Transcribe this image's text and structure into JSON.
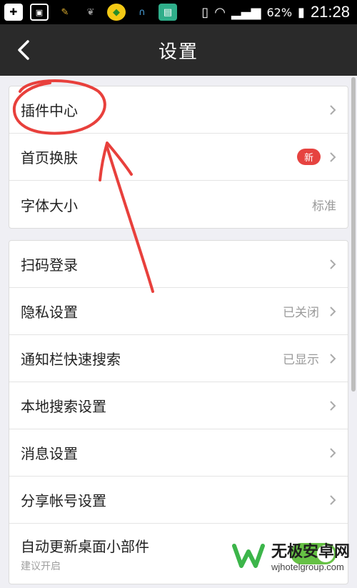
{
  "status_bar": {
    "battery": "62%",
    "time": "21:28"
  },
  "header": {
    "title": "设置"
  },
  "groups": [
    {
      "items": [
        {
          "label": "插件中心"
        },
        {
          "label": "首页换肤",
          "badge": "新"
        },
        {
          "label": "字体大小",
          "value": "标准"
        }
      ]
    },
    {
      "items": [
        {
          "label": "扫码登录"
        },
        {
          "label": "隐私设置",
          "value": "已关闭"
        },
        {
          "label": "通知栏快速搜索",
          "value": "已显示"
        },
        {
          "label": "本地搜索设置"
        },
        {
          "label": "消息设置"
        },
        {
          "label": "分享帐号设置"
        },
        {
          "label": "自动更新桌面小部件",
          "sub": "建议开启",
          "toggle_on": true
        }
      ]
    }
  ],
  "watermark": {
    "title": "无极安卓网",
    "url": "wjhotelgroup.com"
  },
  "colors": {
    "toggle_on": "#66c145",
    "badge": "#e64340",
    "annotation": "#e8403c"
  }
}
